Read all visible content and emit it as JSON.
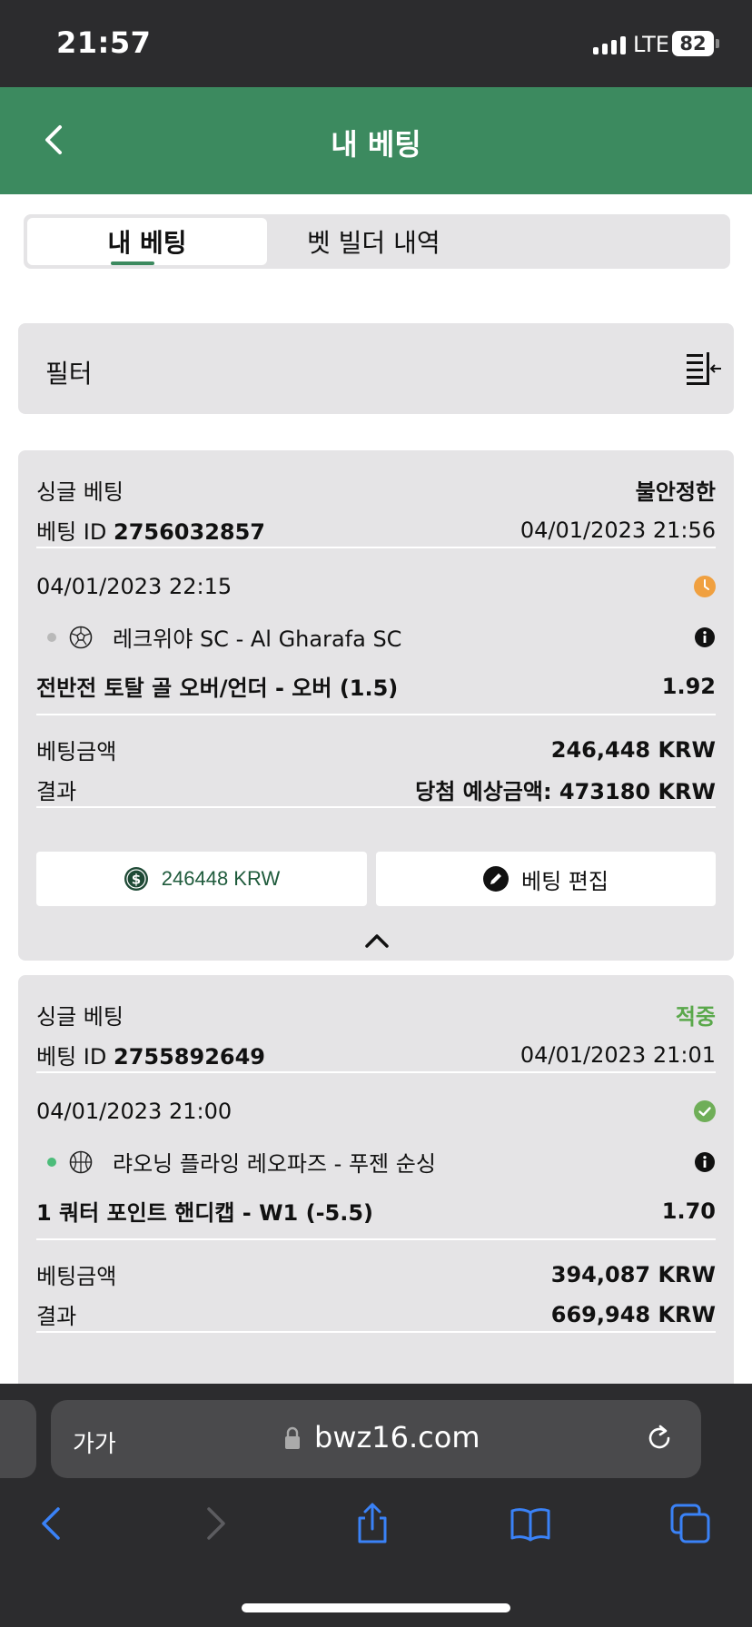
{
  "status_bar": {
    "time": "21:57",
    "network": "LTE",
    "battery": "82"
  },
  "header": {
    "title": "내 베팅"
  },
  "tabs": [
    {
      "label": "내 베팅",
      "active": true
    },
    {
      "label": "벳 빌더 내역",
      "active": false
    }
  ],
  "filter": {
    "label": "필터"
  },
  "bets": [
    {
      "type": "싱글 베팅",
      "status": "불안정한",
      "id_label": "베팅 ID",
      "id": "2756032857",
      "placed_at": "04/01/2023 21:56",
      "event_time": "04/01/2023 22:15",
      "event_name": "레크위야 SC - Al Gharafa SC",
      "market": "전반전 토탈 골 오버/언더 - 오버 (1.5)",
      "odds": "1.92",
      "stake_label": "베팅금액",
      "stake": "246,448 KRW",
      "result_label": "결과",
      "result": "당첨 예상금액: 473180 KRW",
      "cashout_label": "246448  KRW",
      "edit_label": "베팅 편집"
    },
    {
      "type": "싱글 베팅",
      "status": "적중",
      "id_label": "베팅 ID",
      "id": "2755892649",
      "placed_at": "04/01/2023 21:01",
      "event_time": "04/01/2023 21:00",
      "event_name": "랴오닝 플라잉 레오파즈 - 푸젠 순싱",
      "market": "1 쿼터 포인트 핸디캡 - W1 (-5.5)",
      "odds": "1.70",
      "stake_label": "베팅금액",
      "stake": "394,087 KRW",
      "result_label": "결과",
      "result": "669,948 KRW"
    }
  ],
  "browser": {
    "text_size": "가가",
    "url": "bwz16.com"
  },
  "colors": {
    "header_green": "#3c8a5f",
    "won_green": "#5aa84b",
    "pending_orange": "#f0a040"
  }
}
